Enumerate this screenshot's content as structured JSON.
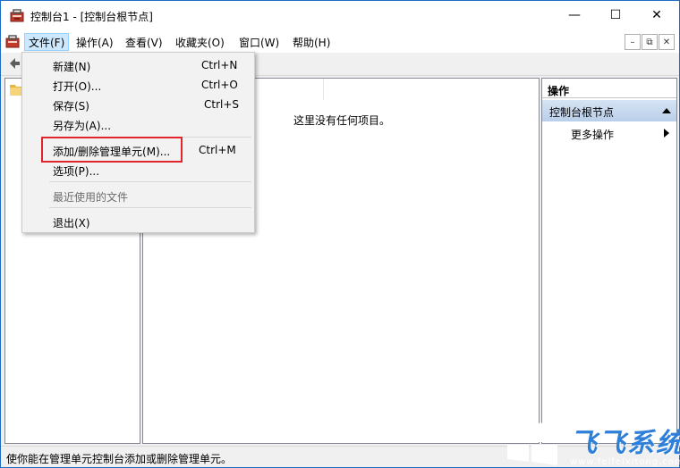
{
  "window": {
    "title": "控制台1 - [控制台根节点]",
    "min_symbol": "—",
    "max_symbol": "☐",
    "close_symbol": "✕"
  },
  "menubar": {
    "items": [
      "文件(F)",
      "操作(A)",
      "查看(V)",
      "收藏夹(O)",
      "窗口(W)",
      "帮助(H)"
    ],
    "active_index": 0,
    "mdi_min": "–",
    "mdi_restore": "⧉",
    "mdi_close": "✕"
  },
  "file_menu": {
    "items": [
      {
        "label": "新建(N)",
        "shortcut": "Ctrl+N"
      },
      {
        "label": "打开(O)...",
        "shortcut": "Ctrl+O"
      },
      {
        "label": "保存(S)",
        "shortcut": "Ctrl+S"
      },
      {
        "label": "另存为(A)...",
        "shortcut": ""
      },
      {
        "label": "添加/删除管理单元(M)...",
        "shortcut": "Ctrl+M"
      },
      {
        "label": "选项(P)...",
        "shortcut": ""
      },
      {
        "label": "最近使用的文件",
        "shortcut": ""
      },
      {
        "label": "退出(X)",
        "shortcut": ""
      }
    ],
    "highlight_color": "#e0262b"
  },
  "center": {
    "empty_text": "这里没有任何项目。"
  },
  "actions": {
    "header": "操作",
    "section": "控制台根节点",
    "more": "更多操作"
  },
  "statusbar": {
    "text": "使你能在管理单元控制台添加或删除管理单元。"
  },
  "watermark": {
    "title": "飞飞系统",
    "url": "www.feifeixitong.com"
  },
  "colors": {
    "accent": "#1b6dc1",
    "menu_active": "#cce8ff",
    "section_bg": "#c9dbef"
  },
  "icons": {
    "app": "mmc-toolbox-icon",
    "back": "back-arrow-icon",
    "folder": "folder-icon"
  }
}
